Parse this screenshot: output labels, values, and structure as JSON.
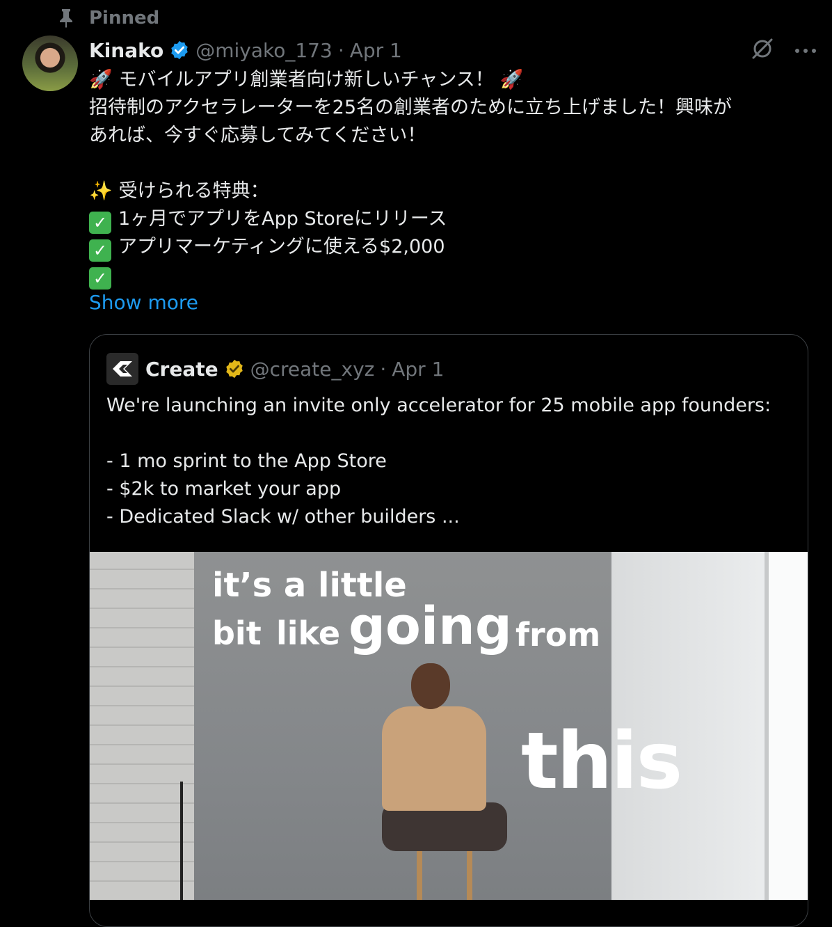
{
  "pinned": {
    "label": "Pinned"
  },
  "tweet": {
    "author_name": "Kinako",
    "handle": "@miyako_173",
    "separator": "·",
    "date": "Apr 1",
    "lines": [
      "モバイルアプリ創業者向け新しいチャンス！",
      "招待制のアクセラレーターを25名の創業者のために立ち上げました！興味が",
      "あれば、今すぐ応募してみてください！",
      "",
      "受けられる特典：",
      "1ヶ月でアプリをApp Storeにリリース",
      "アプリマーケティングに使える$2,000",
      ""
    ],
    "show_more": "Show more"
  },
  "quote": {
    "author_name": "Create",
    "handle": "@create_xyz",
    "separator": "·",
    "date": "Apr 1",
    "lines": [
      "We're launching an invite only accelerator for 25 mobile app founders:",
      "",
      "- 1 mo sprint to the App Store",
      "- $2k to market your app",
      "- Dedicated Slack w/ other builders ..."
    ],
    "video_caption": {
      "line1": "it’s a little",
      "word_bit": "bit",
      "word_like": "like",
      "word_going": "going",
      "word_from": "from",
      "word_this": "this"
    }
  },
  "icons": {
    "pin": "pin-icon",
    "verified": "verified-badge-icon",
    "gold_verified": "gold-verified-badge-icon",
    "grok": "grok-icon",
    "more": "more-icon",
    "rocket": "rocket-icon",
    "sparkles": "sparkles-icon",
    "check": "check-mark-icon"
  },
  "colors": {
    "background": "#000000",
    "link": "#1d9bf0",
    "muted": "#71767b",
    "verified": "#1d9bf0",
    "gold_verified": "#e2b719",
    "check": "#3fb24f"
  }
}
